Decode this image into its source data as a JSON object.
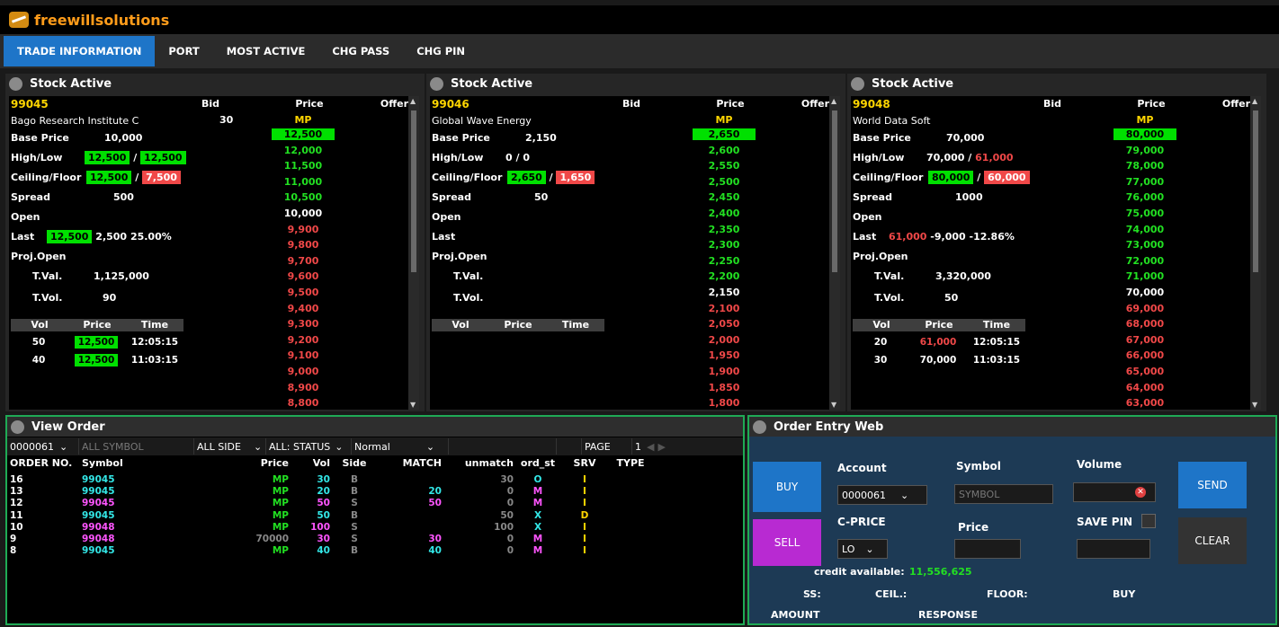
{
  "app": {
    "title": "freewillsolutions"
  },
  "nav": {
    "tabs": [
      "TRADE INFORMATION",
      "PORT",
      "MOST ACTIVE",
      "CHG PASS",
      "CHG PIN"
    ]
  },
  "stock_panels": [
    {
      "title": "Stock Active",
      "symbol": "99045",
      "name": "Bago Research Institute C",
      "base_label": "Base Price",
      "base": "10,000",
      "hl_label": "High/Low",
      "high": "12,500",
      "low": "12,500",
      "cf_label": "Ceiling/Floor",
      "ceiling": "12,500",
      "floor": "7,500",
      "spread_label": "Spread",
      "spread": "500",
      "open_label": "Open",
      "open": "",
      "last_label": "Last",
      "last": "12,500",
      "chg": "2,500",
      "pct": "25.00%",
      "proj_label": "Proj.Open",
      "tval_label": "T.Val.",
      "tval": "1,125,000",
      "tvol_label": "T.Vol.",
      "tvol": "90",
      "bid_hd": "Bid",
      "price_hd": "Price",
      "offer_hd": "Offer",
      "mp": "MP",
      "mp_bid": "30",
      "trade_hd": [
        "Vol",
        "Price",
        "Time"
      ],
      "trades": [
        [
          "50",
          "12,500",
          "12:05:15"
        ],
        [
          "40",
          "12,500",
          "11:03:15"
        ]
      ],
      "ladder": [
        "12,500",
        "12,000",
        "11,500",
        "11,000",
        "10,500",
        "10,000",
        "9,900",
        "9,800",
        "9,700",
        "9,600",
        "9,500",
        "9,400",
        "9,300",
        "9,200",
        "9,100",
        "9,000",
        "8,900",
        "8,800"
      ]
    },
    {
      "title": "Stock Active",
      "symbol": "99046",
      "name": "Global Wave Energy",
      "base_label": "Base Price",
      "base": "2,150",
      "hl_label": "High/Low",
      "high": "0",
      "low": "0",
      "cf_label": "Ceiling/Floor",
      "ceiling": "2,650",
      "floor": "1,650",
      "spread_label": "Spread",
      "spread": "50",
      "open_label": "Open",
      "open": "",
      "last_label": "Last",
      "last": "",
      "chg": "",
      "pct": "",
      "proj_label": "Proj.Open",
      "tval_label": "T.Val.",
      "tval": "",
      "tvol_label": "T.Vol.",
      "tvol": "",
      "bid_hd": "Bid",
      "price_hd": "Price",
      "offer_hd": "Offer",
      "mp": "MP",
      "mp_bid": "",
      "trade_hd": [
        "Vol",
        "Price",
        "Time"
      ],
      "trades": [],
      "ladder": [
        "2,650",
        "2,600",
        "2,550",
        "2,500",
        "2,450",
        "2,400",
        "2,350",
        "2,300",
        "2,250",
        "2,200",
        "2,150",
        "2,100",
        "2,050",
        "2,000",
        "1,950",
        "1,900",
        "1,850",
        "1,800"
      ]
    },
    {
      "title": "Stock Active",
      "symbol": "99048",
      "name": "World Data Soft",
      "base_label": "Base Price",
      "base": "70,000",
      "hl_label": "High/Low",
      "high": "70,000",
      "low": "61,000",
      "cf_label": "Ceiling/Floor",
      "ceiling": "80,000",
      "floor": "60,000",
      "spread_label": "Spread",
      "spread": "1000",
      "open_label": "Open",
      "open": "",
      "last_label": "Last",
      "last": "61,000",
      "chg": "-9,000",
      "pct": "-12.86%",
      "proj_label": "Proj.Open",
      "tval_label": "T.Val.",
      "tval": "3,320,000",
      "tvol_label": "T.Vol.",
      "tvol": "50",
      "bid_hd": "Bid",
      "price_hd": "Price",
      "offer_hd": "Offer",
      "mp": "MP",
      "mp_bid": "",
      "trade_hd": [
        "Vol",
        "Price",
        "Time"
      ],
      "trades": [
        [
          "20",
          "61,000",
          "12:05:15"
        ],
        [
          "30",
          "70,000",
          "11:03:15"
        ]
      ],
      "ladder": [
        "80,000",
        "79,000",
        "78,000",
        "77,000",
        "76,000",
        "75,000",
        "74,000",
        "73,000",
        "72,000",
        "71,000",
        "70,000",
        "69,000",
        "68,000",
        "67,000",
        "66,000",
        "65,000",
        "64,000",
        "63,000"
      ]
    }
  ],
  "view_order": {
    "title": "View Order",
    "account": "0000061",
    "symbol_placeholder": "ALL SYMBOL",
    "side": "ALL SIDE",
    "status": "ALL: STATUS",
    "mode": "Normal",
    "page_label": "PAGE",
    "page": "1",
    "headers": [
      "ORDER NO.",
      "Symbol",
      "Price",
      "Vol",
      "Side",
      "MATCH",
      "unmatch",
      "ord_st",
      "SRV",
      "TYPE"
    ],
    "rows": [
      [
        "16",
        "99045",
        "MP",
        "30",
        "B",
        "",
        "30",
        "O",
        "I",
        ""
      ],
      [
        "13",
        "99045",
        "MP",
        "20",
        "B",
        "20",
        "0",
        "M",
        "I",
        ""
      ],
      [
        "12",
        "99045",
        "MP",
        "50",
        "S",
        "50",
        "0",
        "M",
        "I",
        ""
      ],
      [
        "11",
        "99045",
        "MP",
        "50",
        "B",
        "",
        "50",
        "X",
        "D",
        ""
      ],
      [
        "10",
        "99048",
        "MP",
        "100",
        "S",
        "",
        "100",
        "X",
        "I",
        ""
      ],
      [
        "9",
        "99048",
        "70000",
        "30",
        "S",
        "30",
        "0",
        "M",
        "I",
        ""
      ],
      [
        "8",
        "99045",
        "MP",
        "40",
        "B",
        "40",
        "0",
        "M",
        "I",
        ""
      ]
    ]
  },
  "order_entry": {
    "title": "Order Entry Web",
    "buy": "BUY",
    "sell": "SELL",
    "send": "SEND",
    "clear": "CLEAR",
    "account_label": "Account",
    "account": "0000061",
    "symbol_label": "Symbol",
    "symbol_placeholder": "SYMBOL",
    "volume_label": "Volume",
    "cprice_label": "C-PRICE",
    "cprice": "LO",
    "price_label": "Price",
    "savepin_label": "SAVE PIN",
    "credit_label": "credit available:",
    "credit": "11,556,625",
    "ss_label": "SS:",
    "ceil_label": "CEIL.:",
    "floor_label": "FLOOR:",
    "buy_label": "BUY",
    "amount_label": "AMOUNT",
    "response_label": "RESPONSE"
  }
}
